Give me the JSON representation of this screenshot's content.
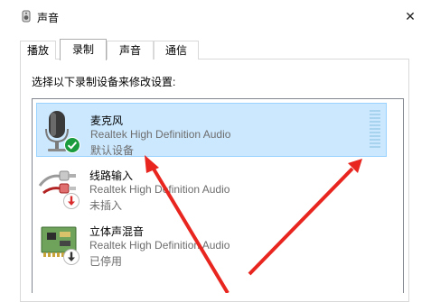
{
  "window": {
    "title": "声音",
    "close_symbol": "✕"
  },
  "tabs": [
    {
      "label": "播放"
    },
    {
      "label": "录制"
    },
    {
      "label": "声音"
    },
    {
      "label": "通信"
    }
  ],
  "active_tab": "录制",
  "instruction": "选择以下录制设备来修改设置:",
  "devices": [
    {
      "name": "麦克风",
      "driver": "Realtek High Definition Audio",
      "status": "默认设备",
      "icon": "microphone-icon",
      "badge": "check-badge-icon",
      "selected": true
    },
    {
      "name": "线路输入",
      "driver": "Realtek High Definition Audio",
      "status": "未插入",
      "icon": "line-in-plug-icon",
      "badge": "unplugged-badge-icon",
      "selected": false
    },
    {
      "name": "立体声混音",
      "driver": "Realtek High Definition Audio",
      "status": "已停用",
      "icon": "circuit-board-icon",
      "badge": "disabled-badge-icon",
      "selected": false
    }
  ],
  "colors": {
    "selection_bg": "#cce8ff",
    "selection_border": "#99d1ff",
    "level_meter": "#a8d3ee",
    "annotation_arrow": "#e8251f",
    "default_badge": "#1a9b3e",
    "unplugged_badge": "#d92b2b"
  }
}
